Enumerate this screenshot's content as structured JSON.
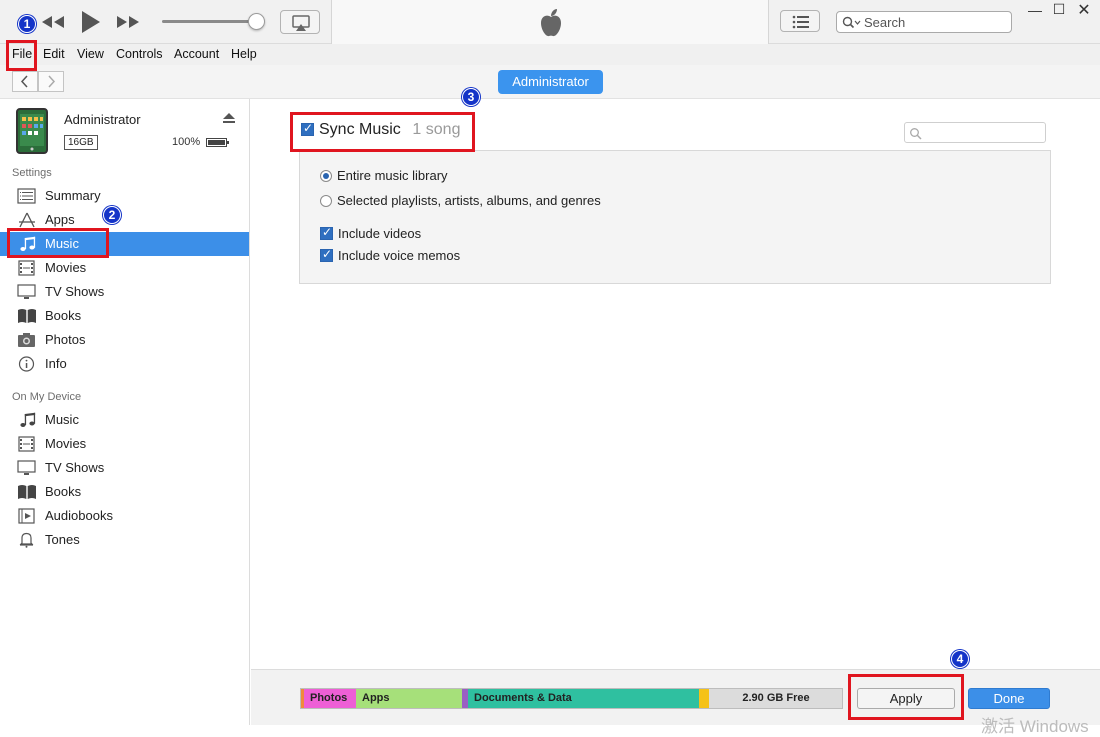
{
  "menubar": {
    "items": [
      "File",
      "Edit",
      "View",
      "Controls",
      "Account",
      "Help"
    ]
  },
  "titlebar": {
    "search_placeholder": "Search"
  },
  "nav": {
    "device_button": "Administrator"
  },
  "device": {
    "name": "Administrator",
    "capacity": "16GB",
    "battery": "100%"
  },
  "sidebar": {
    "settings_header": "Settings",
    "settings_items": [
      {
        "label": "Summary",
        "icon": "summary-icon"
      },
      {
        "label": "Apps",
        "icon": "apps-icon"
      },
      {
        "label": "Music",
        "icon": "music-icon",
        "selected": true
      },
      {
        "label": "Movies",
        "icon": "movies-icon"
      },
      {
        "label": "TV Shows",
        "icon": "tv-icon"
      },
      {
        "label": "Books",
        "icon": "books-icon"
      },
      {
        "label": "Photos",
        "icon": "camera-icon"
      },
      {
        "label": "Info",
        "icon": "info-icon"
      }
    ],
    "device_header": "On My Device",
    "device_items": [
      {
        "label": "Music",
        "icon": "music-icon"
      },
      {
        "label": "Movies",
        "icon": "movies-icon"
      },
      {
        "label": "TV Shows",
        "icon": "tv-icon"
      },
      {
        "label": "Books",
        "icon": "books-icon"
      },
      {
        "label": "Audiobooks",
        "icon": "audiobook-icon"
      },
      {
        "label": "Tones",
        "icon": "bell-icon"
      }
    ]
  },
  "main": {
    "sync_label": "Sync Music",
    "sync_count": "1 song",
    "options": {
      "entire": "Entire music library",
      "selected": "Selected playlists, artists, albums, and genres",
      "include_videos": "Include videos",
      "include_memos": "Include voice memos"
    }
  },
  "storage": {
    "photos": "Photos",
    "apps": "Apps",
    "docs": "Documents & Data",
    "free": "2.90 GB Free"
  },
  "buttons": {
    "apply": "Apply",
    "done": "Done"
  },
  "annotations": {
    "b1": "1",
    "b2": "2",
    "b3": "3",
    "b4": "4"
  },
  "watermark": "激活 Windows",
  "colors": {
    "accent": "#3c8fe8",
    "photos_seg": "#ee5fd6",
    "apps_seg": "#a6e07a",
    "docs_seg": "#2fc0a0",
    "other_seg": "#f5c218",
    "free_seg": "#dcdcdc",
    "annotation_red": "#e0151f",
    "annotation_badge": "#1434c8"
  }
}
